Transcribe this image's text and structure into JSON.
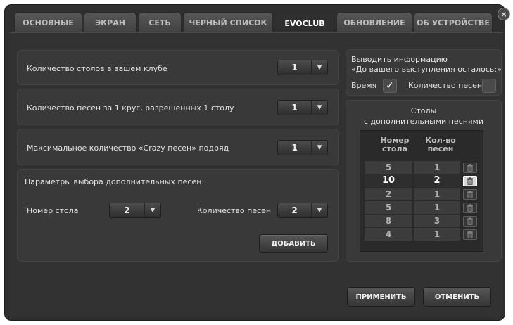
{
  "tabs": [
    {
      "label": "ОСНОВНЫЕ",
      "active": false
    },
    {
      "label": "ЭКРАН",
      "active": false
    },
    {
      "label": "СЕТЬ",
      "active": false
    },
    {
      "label": "ЧЕРНЫЙ СПИСОК",
      "active": false
    },
    {
      "label": "EVOCLUB",
      "active": true
    },
    {
      "label": "ОБНОВЛЕНИЕ",
      "active": false
    },
    {
      "label": "ОБ УСТРОЙСТВЕ",
      "active": false
    }
  ],
  "close_glyph": "×",
  "settings": {
    "tables_count": {
      "label": "Количество столов в вашем клубе",
      "value": "1"
    },
    "songs_per_round": {
      "label": "Количество песен за 1 круг, разрешенных 1 столу",
      "value": "1"
    },
    "max_crazy": {
      "label": "Максимальное количество «Crazy песен» подряд",
      "value": "1"
    }
  },
  "extra": {
    "title": "Параметры выбора дополнительных песен:",
    "table_label": "Номер стола",
    "table_value": "2",
    "count_label": "Количество песен",
    "count_value": "2",
    "add_button": "ДОБАВИТЬ"
  },
  "info": {
    "line1": "Выводить информацию",
    "line2": "«До вашего выступления осталось:»",
    "time_label": "Время",
    "time_checked": true,
    "songs_label": "Количество песен",
    "songs_checked": false,
    "check_glyph": "✓"
  },
  "tables": {
    "title1": "Столы",
    "title2": "с дополнительными песнями",
    "col1_line1": "Номер",
    "col1_line2": "стола",
    "col2_line1": "Кол-во",
    "col2_line2": "песен",
    "rows": [
      {
        "table": "5",
        "count": "1",
        "selected": false
      },
      {
        "table": "10",
        "count": "2",
        "selected": true
      },
      {
        "table": "2",
        "count": "1",
        "selected": false
      },
      {
        "table": "5",
        "count": "1",
        "selected": false
      },
      {
        "table": "8",
        "count": "3",
        "selected": false
      },
      {
        "table": "4",
        "count": "1",
        "selected": false
      }
    ]
  },
  "buttons": {
    "apply": "ПРИМЕНИТЬ",
    "cancel": "ОТМЕНИТЬ"
  },
  "dropdown_arrow": "▼"
}
